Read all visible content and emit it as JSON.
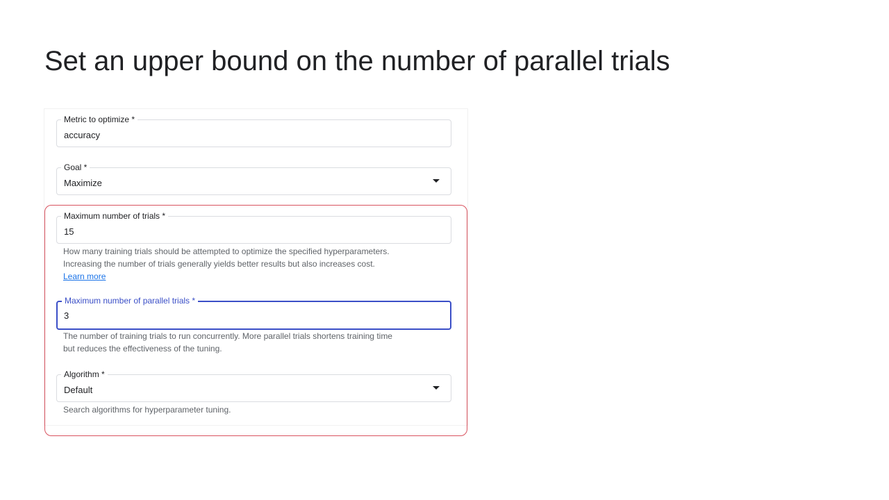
{
  "title": "Set an upper bound on the number of parallel trials",
  "form": {
    "metric": {
      "label": "Metric to optimize *",
      "value": "accuracy"
    },
    "goal": {
      "label": "Goal *",
      "value": "Maximize"
    },
    "max_trials": {
      "label": "Maximum number of trials *",
      "value": "15",
      "help1": "How many training trials should be attempted to optimize the specified hyperparameters.",
      "help2": "Increasing the number of trials generally yields better results but also increases cost.",
      "link": "Learn more"
    },
    "parallel": {
      "label": "Maximum number of parallel trials *",
      "value": "3",
      "help1": "The number of training trials to run concurrently. More parallel trials shortens training time",
      "help2": "but reduces the effectiveness of the tuning."
    },
    "algorithm": {
      "label": "Algorithm *",
      "value": "Default",
      "help": "Search algorithms for hyperparameter tuning."
    }
  },
  "colors": {
    "highlight": "#d9535f",
    "focus": "#3b4fc7"
  }
}
